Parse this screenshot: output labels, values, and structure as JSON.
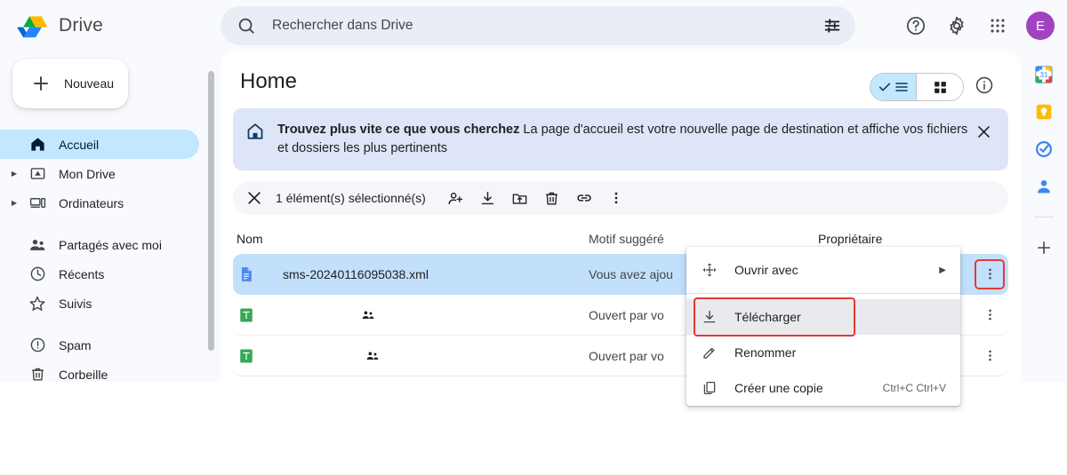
{
  "app": {
    "brand": "Drive",
    "logo_colors": {
      "blue": "#1a73e8",
      "green": "#34a853",
      "yellow": "#fbbc04"
    }
  },
  "search": {
    "placeholder": "Rechercher dans Drive",
    "value": "",
    "icon": "search-icon",
    "tune_icon": "tune-icon"
  },
  "topbar": {
    "help_icon": "help-circle-icon",
    "settings_icon": "gear-icon",
    "apps_icon": "apps-grid-icon",
    "avatar_letter": "E",
    "avatar_color": "#a142c0"
  },
  "sidebar": {
    "new_button": {
      "label": "Nouveau",
      "icon": "plus-icon"
    },
    "items": [
      {
        "label": "Accueil",
        "icon": "home-icon",
        "active": true,
        "expandable": false
      },
      {
        "label": "Mon Drive",
        "icon": "drive-folder-icon",
        "active": false,
        "expandable": true
      },
      {
        "label": "Ordinateurs",
        "icon": "computer-icon",
        "active": false,
        "expandable": true
      },
      {
        "label": "Partagés avec moi",
        "icon": "people-icon",
        "active": false,
        "expandable": false
      },
      {
        "label": "Récents",
        "icon": "clock-icon",
        "active": false,
        "expandable": false
      },
      {
        "label": "Suivis",
        "icon": "star-icon",
        "active": false,
        "expandable": false
      },
      {
        "label": "Spam",
        "icon": "spam-icon",
        "active": false,
        "expandable": false
      },
      {
        "label": "Corbeille",
        "icon": "trash-icon",
        "active": false,
        "expandable": false
      }
    ]
  },
  "main": {
    "title": "Home",
    "view_toggle": {
      "list_label": "list-view",
      "grid_label": "grid-view",
      "selected": "list"
    },
    "info_icon": "info-circle-icon",
    "banner": {
      "icon": "home-outline-icon",
      "headline": "Trouvez plus vite ce que vous cherchez",
      "body": "La page d'accueil est votre nouvelle page de destination et affiche vos fichiers et dossiers les plus pertinents",
      "close_icon": "close-icon"
    },
    "selection_toolbar": {
      "close_icon": "close-icon",
      "count_label": "1 élément(s) sélectionné(s)",
      "actions": [
        {
          "name": "share-action",
          "icon": "person-add-icon"
        },
        {
          "name": "download-action",
          "icon": "download-icon"
        },
        {
          "name": "move-action",
          "icon": "move-to-folder-icon"
        },
        {
          "name": "delete-action",
          "icon": "trash-icon"
        },
        {
          "name": "link-action",
          "icon": "link-icon"
        },
        {
          "name": "more-action",
          "icon": "kebab-icon"
        }
      ]
    },
    "table": {
      "columns": {
        "name": "Nom",
        "reason": "Motif suggéré",
        "owner": "Propriétaire"
      },
      "rows": [
        {
          "file_type": "xml-document",
          "name": "sms-20240116095038.xml",
          "reason": "Vous avez ajou",
          "owner": "",
          "selected": true,
          "shared": false,
          "kebab_highlighted": true
        },
        {
          "file_type": "google-sheet",
          "name": "",
          "reason": "Ouvert par vo",
          "owner": "",
          "selected": false,
          "shared": true,
          "kebab_highlighted": false
        },
        {
          "file_type": "google-sheet",
          "name": "",
          "reason": "Ouvert par vo",
          "owner": "",
          "selected": false,
          "shared": true,
          "kebab_highlighted": false
        }
      ]
    }
  },
  "context_menu": {
    "items": [
      {
        "label": "Ouvrir avec",
        "icon": "open-with-icon",
        "submenu": true,
        "shortcut": "",
        "state": "normal"
      },
      {
        "label": "Télécharger",
        "icon": "download-icon",
        "submenu": false,
        "shortcut": "",
        "state": "outlined"
      },
      {
        "label": "Renommer",
        "icon": "pencil-icon",
        "submenu": false,
        "shortcut": "",
        "state": "normal"
      },
      {
        "label": "Créer une copie",
        "icon": "copy-icon",
        "submenu": false,
        "shortcut": "Ctrl+C Ctrl+V",
        "state": "normal"
      }
    ]
  },
  "right_rail": {
    "items": [
      {
        "name": "google-calendar-icon",
        "label": "31",
        "color": "#1a73e8"
      },
      {
        "name": "google-keep-icon",
        "label": "",
        "color": "#fbbc04"
      },
      {
        "name": "google-tasks-icon",
        "label": "",
        "color": "#1a73e8"
      },
      {
        "name": "google-contacts-icon",
        "label": "",
        "color": "#1a73e8"
      }
    ],
    "add_icon": "plus-icon"
  },
  "highlight_color": "#e53935"
}
